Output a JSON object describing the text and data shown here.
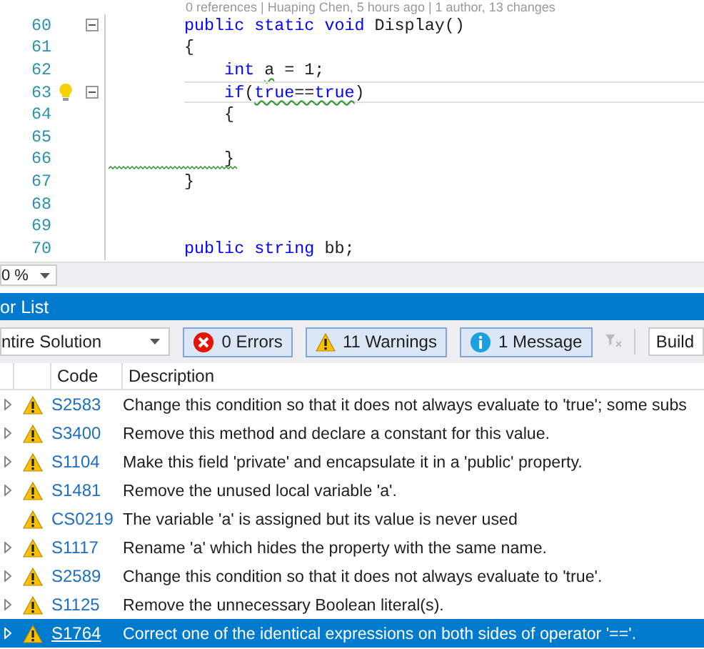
{
  "editor": {
    "codelens": "0 references | Huaping Chen, 5 hours ago | 1 author, 13 changes",
    "lines": [
      {
        "number": "60",
        "foldable": true,
        "lightbulb": false,
        "current": false,
        "squiggle_margin": false,
        "segments": [
          {
            "kind": "keyword",
            "text": "public static void"
          },
          {
            "kind": "text",
            "text": " Display()"
          }
        ]
      },
      {
        "number": "61",
        "foldable": false,
        "lightbulb": false,
        "current": false,
        "squiggle_margin": false,
        "segments": [
          {
            "kind": "text",
            "text": "{"
          }
        ]
      },
      {
        "number": "62",
        "foldable": false,
        "lightbulb": false,
        "current": false,
        "squiggle_margin": false,
        "segments": [
          {
            "kind": "keyword",
            "text": "    int "
          },
          {
            "kind": "flagged-text",
            "text": "a"
          },
          {
            "kind": "text",
            "text": " = 1;"
          }
        ]
      },
      {
        "number": "63",
        "foldable": true,
        "lightbulb": true,
        "current": true,
        "squiggle_margin": false,
        "segments": [
          {
            "kind": "keyword",
            "text": "    if"
          },
          {
            "kind": "text",
            "text": "("
          },
          {
            "kind": "flagged-keyword",
            "text": "true"
          },
          {
            "kind": "flagged-text",
            "text": "=="
          },
          {
            "kind": "flagged-keyword",
            "text": "true"
          },
          {
            "kind": "text",
            "text": ")"
          }
        ]
      },
      {
        "number": "64",
        "foldable": false,
        "lightbulb": false,
        "current": false,
        "squiggle_margin": false,
        "segments": [
          {
            "kind": "text",
            "text": "    {"
          }
        ]
      },
      {
        "number": "65",
        "foldable": false,
        "lightbulb": false,
        "current": false,
        "squiggle_margin": false
      },
      {
        "number": "66",
        "foldable": false,
        "lightbulb": false,
        "current": false,
        "squiggle_margin": true,
        "segments": [
          {
            "kind": "text",
            "text": "    }"
          }
        ]
      },
      {
        "number": "67",
        "foldable": false,
        "lightbulb": false,
        "current": false,
        "squiggle_margin": false,
        "segments": [
          {
            "kind": "text",
            "text": "}"
          }
        ]
      },
      {
        "number": "68",
        "foldable": false,
        "lightbulb": false,
        "current": false,
        "squiggle_margin": false
      },
      {
        "number": "69",
        "foldable": false,
        "lightbulb": false,
        "current": false,
        "squiggle_margin": false
      },
      {
        "number": "70",
        "foldable": false,
        "lightbulb": false,
        "current": false,
        "squiggle_margin": false,
        "segments": [
          {
            "kind": "keyword",
            "text": "public string"
          },
          {
            "kind": "text",
            "text": " bb;"
          }
        ]
      }
    ]
  },
  "zoom": {
    "value": "0 %"
  },
  "error_list": {
    "title": "or List",
    "scope": {
      "value": "ntire Solution"
    },
    "filters": [
      {
        "kind": "error",
        "label": "0 Errors",
        "selected": true
      },
      {
        "kind": "warning",
        "label": "11 Warnings",
        "selected": true
      },
      {
        "kind": "info",
        "label": "1 Message",
        "selected": true
      }
    ],
    "source": {
      "value": "Build"
    },
    "columns": [
      "Code",
      "Description"
    ],
    "rows": [
      {
        "expandable": true,
        "selected": false,
        "code": "S2583",
        "description": "Change this condition so that it does not always evaluate to 'true'; some subs"
      },
      {
        "expandable": true,
        "selected": false,
        "code": "S3400",
        "description": "Remove this method and declare a constant for this value."
      },
      {
        "expandable": true,
        "selected": false,
        "code": "S1104",
        "description": "Make this field 'private' and encapsulate it in a 'public' property."
      },
      {
        "expandable": true,
        "selected": false,
        "code": "S1481",
        "description": "Remove the unused local variable 'a'."
      },
      {
        "expandable": false,
        "selected": false,
        "code": "CS0219",
        "description": "The variable 'a' is assigned but its value is never used"
      },
      {
        "expandable": true,
        "selected": false,
        "code": "S1117",
        "description": "Rename 'a' which hides the property with the same name."
      },
      {
        "expandable": true,
        "selected": false,
        "code": "S2589",
        "description": "Change this condition so that it does not always evaluate to 'true'."
      },
      {
        "expandable": true,
        "selected": false,
        "code": "S1125",
        "description": "Remove the unnecessary Boolean literal(s)."
      },
      {
        "expandable": true,
        "selected": true,
        "code": "S1764",
        "description": "Correct one of the identical expressions on both sides of operator '=='."
      }
    ]
  }
}
